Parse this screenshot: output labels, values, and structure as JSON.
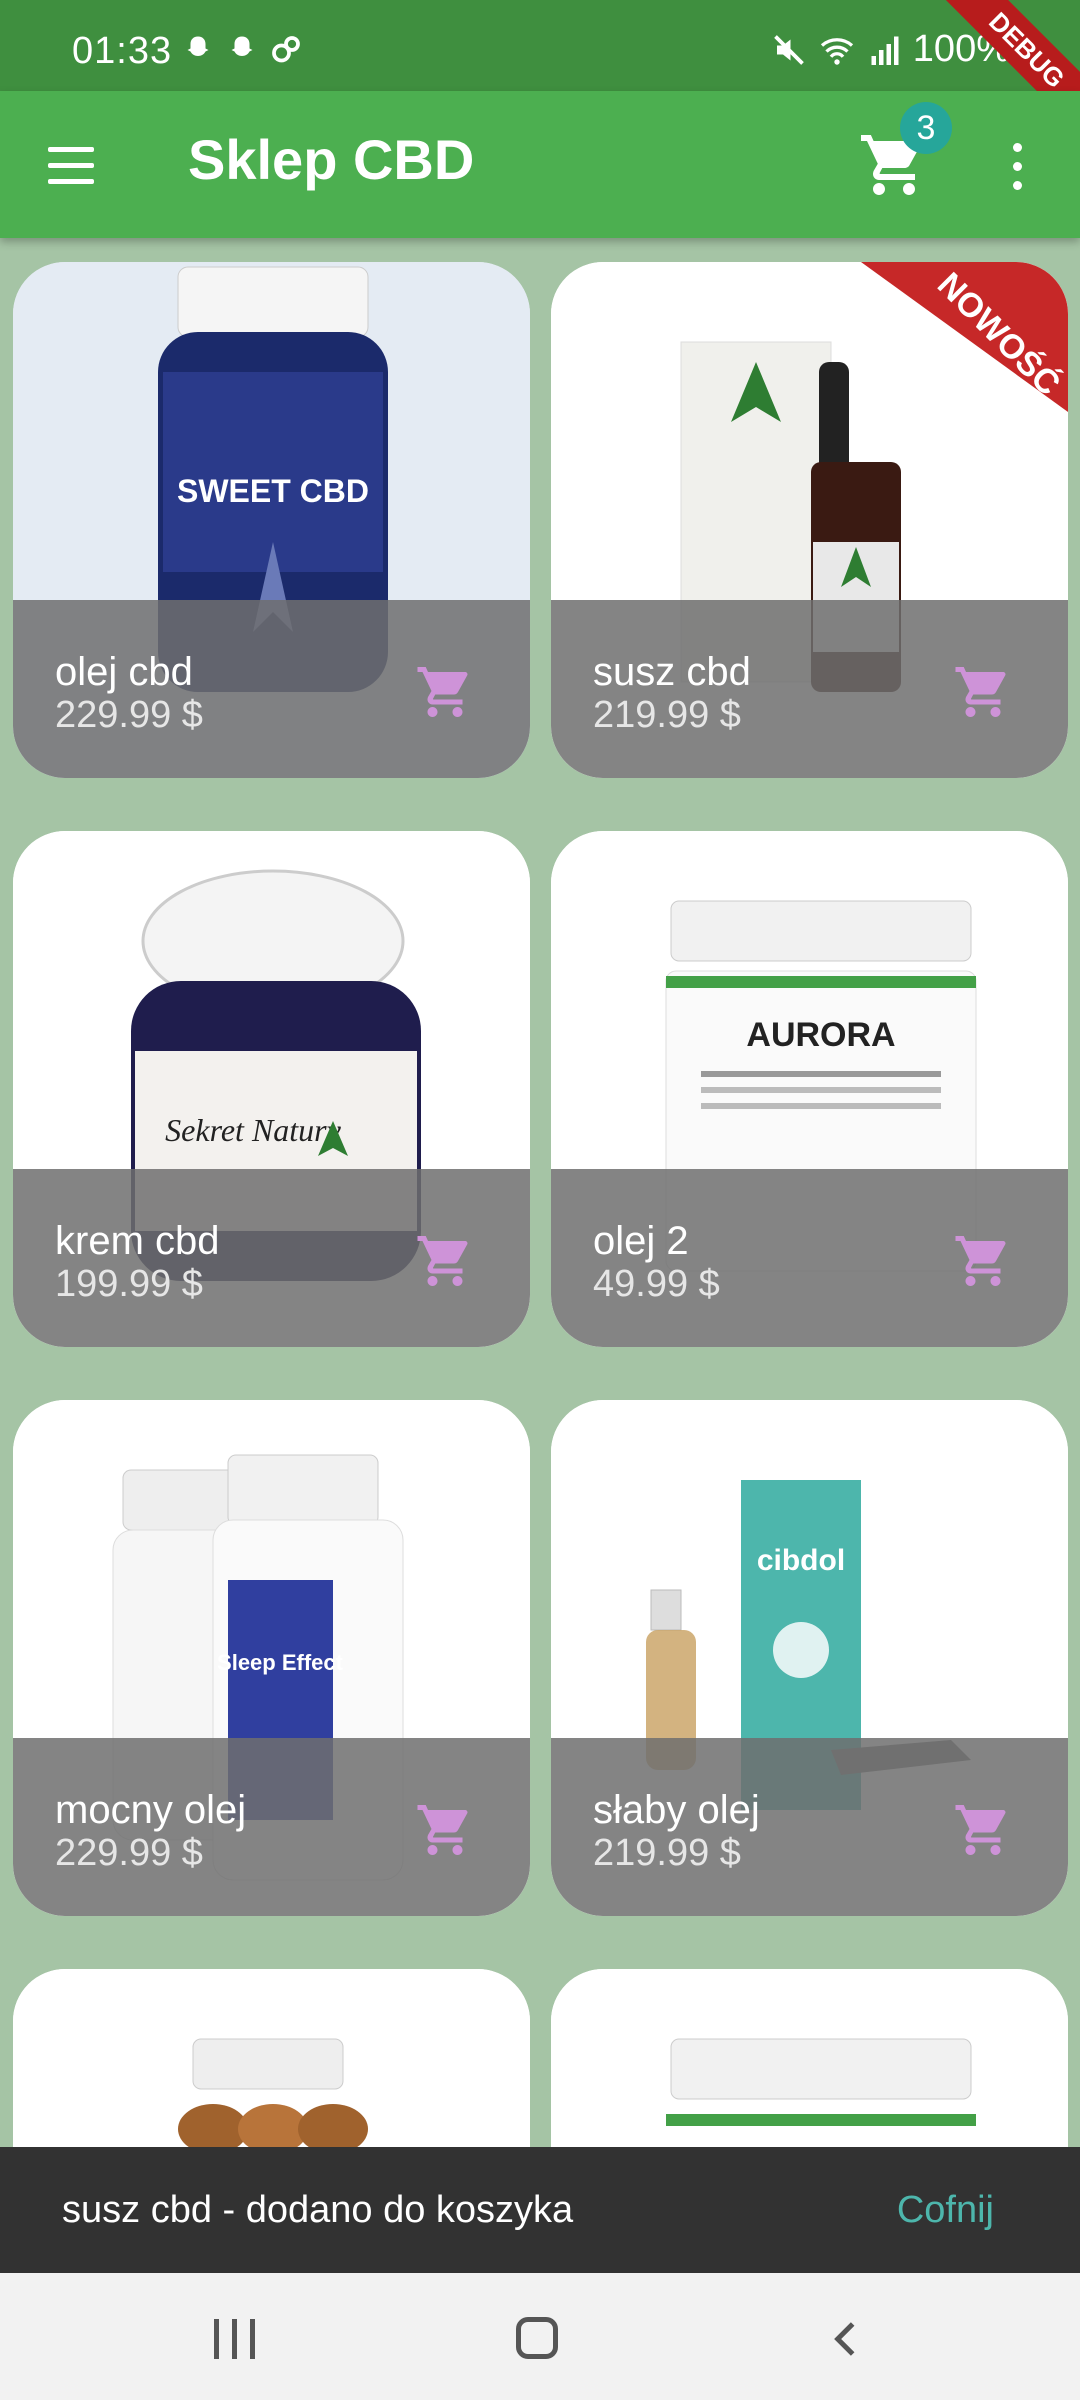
{
  "status_bar": {
    "time": "01:33",
    "battery": "100%",
    "debug_label": "DEBUG"
  },
  "app_bar": {
    "title": "Sklep CBD",
    "cart_count": "3"
  },
  "products": [
    {
      "name": "olej cbd",
      "price": "229.99 $",
      "image": "gummies-jar-sweet-cbd",
      "image_text": "SWEET CBD"
    },
    {
      "name": "susz cbd",
      "price": "219.99 $",
      "image": "oil-bottle-box",
      "ribbon": "NOWOŚĆ"
    },
    {
      "name": "krem cbd",
      "price": "199.99 $",
      "image": "gummies-jar-sekret-natury",
      "image_text": "Sekret Natury"
    },
    {
      "name": "olej 2",
      "price": "49.99 $",
      "image": "tub-aurora",
      "image_text": "AURORA"
    },
    {
      "name": "mocny olej",
      "price": "229.99 $",
      "image": "bottles-sleep-effect",
      "image_text": "Sleep Effect"
    },
    {
      "name": "słaby olej",
      "price": "219.99 $",
      "image": "oil-bottle-cibdol",
      "image_text": "cibdol"
    },
    {
      "name": "",
      "price": "",
      "image": "capsule-jar"
    },
    {
      "name": "",
      "price": "",
      "image": "tub-white"
    }
  ],
  "snackbar": {
    "message": "susz cbd - dodano do koszyka",
    "action": "Cofnij"
  },
  "colors": {
    "app_bar": "#4caf50",
    "status_bar": "#3f8f3f",
    "background": "#a5c4a5",
    "cart_icon": "#ce93d8",
    "snack_action": "#4db6ac"
  }
}
